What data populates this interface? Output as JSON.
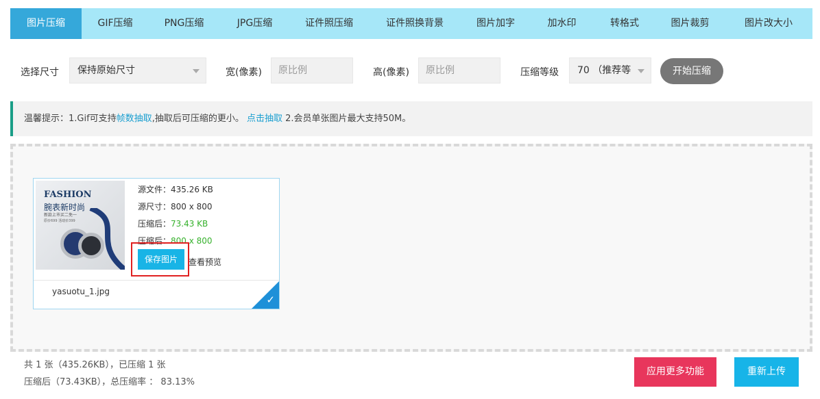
{
  "tabs": [
    {
      "label": "图片压缩",
      "active": true
    },
    {
      "label": "GIF压缩"
    },
    {
      "label": "PNG压缩"
    },
    {
      "label": "JPG压缩"
    },
    {
      "label": "证件照压缩"
    },
    {
      "label": "证件照换背景"
    },
    {
      "label": "图片加字"
    },
    {
      "label": "加水印"
    },
    {
      "label": "转格式"
    },
    {
      "label": "图片裁剪"
    },
    {
      "label": "图片改大小"
    }
  ],
  "options": {
    "size_label": "选择尺寸",
    "size_value": "保持原始尺寸",
    "width_label": "宽(像素)",
    "width_placeholder": "原比例",
    "height_label": "高(像素)",
    "height_placeholder": "原比例",
    "level_label": "压缩等级",
    "level_value": "70 （推荐等",
    "start_button": "开始压缩"
  },
  "tip": {
    "prefix": "温馨提示：1.Gif可支持",
    "link1": "帧数抽取",
    "middle": ",抽取后可压缩的更小。 ",
    "link2": "点击抽取",
    "suffix": " 2.会员单张图片最大支持50M。"
  },
  "file_card": {
    "thumb_title": "FASHION",
    "thumb_subtitle": "腕表新时尚",
    "thumb_line3": "新款上市买二免一",
    "thumb_line4": "原价699 活动价399",
    "source_size": "源文件：435.26 KB",
    "source_dim": "源尺寸：800 x 800",
    "compressed_size_label": "压缩后：",
    "compressed_size_value": "73.43 KB",
    "compressed_dim_label": "压缩后：",
    "compressed_dim_value": "800 x 800",
    "save_button": "保存图片",
    "preview_link": "查看预览",
    "filename": "yasuotu_1.jpg"
  },
  "summary": {
    "line1": "共 1 张（435.26KB），已压缩 1 张",
    "line2": "压缩后（73.43KB），总压缩率 ： 83.13%"
  },
  "buttons": {
    "more_features": "应用更多功能",
    "reupload": "重新上传"
  }
}
